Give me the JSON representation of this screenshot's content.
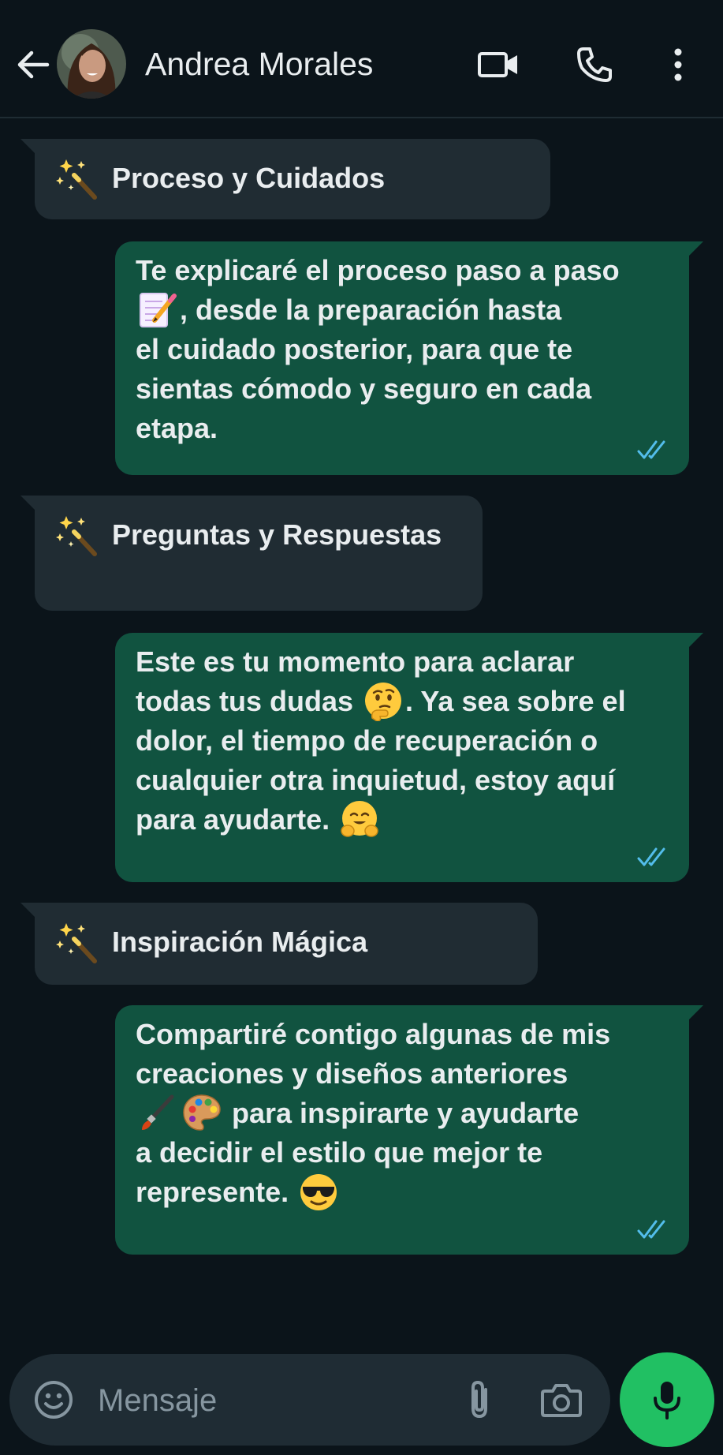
{
  "header": {
    "contact_name": "Andrea Morales",
    "back_icon": "arrow-left-icon",
    "video_icon": "video-call-icon",
    "call_icon": "phone-icon",
    "menu_icon": "more-vertical-icon"
  },
  "messages": [
    {
      "direction": "incoming",
      "emoji": "magic-wand",
      "text": "Proceso y Cuidados"
    },
    {
      "direction": "outgoing",
      "lines": [
        "Te explicaré el proceso paso a paso",
        ", desde la preparación hasta",
        "el cuidado posterior, para que te",
        "sientas cómodo y seguro en cada",
        "etapa."
      ],
      "emojis": [
        "memo"
      ],
      "status": "read"
    },
    {
      "direction": "incoming",
      "emoji": "magic-wand",
      "text": "Preguntas y Respuestas"
    },
    {
      "direction": "outgoing",
      "lines": [
        "Este es tu momento para aclarar",
        "todas tus dudas",
        ". Ya sea sobre el",
        "dolor, el tiempo de recuperación o",
        "cualquier otra inquietud, estoy aquí",
        "para ayudarte."
      ],
      "emojis": [
        "thinking-face",
        "hugging-face"
      ],
      "status": "read"
    },
    {
      "direction": "incoming",
      "emoji": "magic-wand",
      "text": "Inspiración Mágica"
    },
    {
      "direction": "outgoing",
      "lines": [
        "Compartiré contigo algunas de mis",
        "creaciones y diseños anteriores",
        "para inspirarte y ayudarte",
        "a decidir el estilo que mejor te",
        "represente."
      ],
      "emojis": [
        "paintbrush",
        "artist-palette",
        "smiling-face-with-sunglasses"
      ],
      "status": "read"
    }
  ],
  "composer": {
    "placeholder": "Mensaje",
    "emoji_icon": "emoji-icon",
    "attach_icon": "paperclip-icon",
    "camera_icon": "camera-icon",
    "mic_icon": "microphone-icon"
  },
  "colors": {
    "background": "#0b141a",
    "incoming_bubble": "#202c33",
    "outgoing_bubble": "#115340",
    "read_ticks": "#53bdeb",
    "mic_button": "#21c063"
  }
}
